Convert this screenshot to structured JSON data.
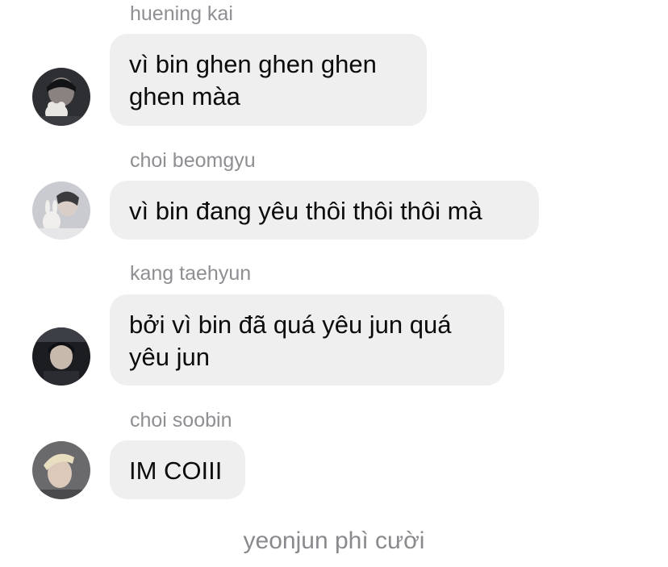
{
  "messages": [
    {
      "sender": "huening kai",
      "text": "vì bin ghen ghen ghen ghen màa",
      "avatar": "huening-kai-avatar"
    },
    {
      "sender": "choi beomgyu",
      "text": "vì bin đang yêu thôi thôi thôi mà",
      "avatar": "choi-beomgyu-avatar"
    },
    {
      "sender": "kang taehyun",
      "text": "bởi vì bin đã quá yêu jun quá yêu jun",
      "avatar": "kang-taehyun-avatar"
    },
    {
      "sender": "choi soobin",
      "text": "IM COIII",
      "avatar": "choi-soobin-avatar"
    }
  ],
  "system_note": "yeonjun phì cười",
  "colors": {
    "bubble": "#efefef",
    "sender": "#8e8e93",
    "text": "#0b0b0b",
    "system": "#8a8a8e"
  }
}
